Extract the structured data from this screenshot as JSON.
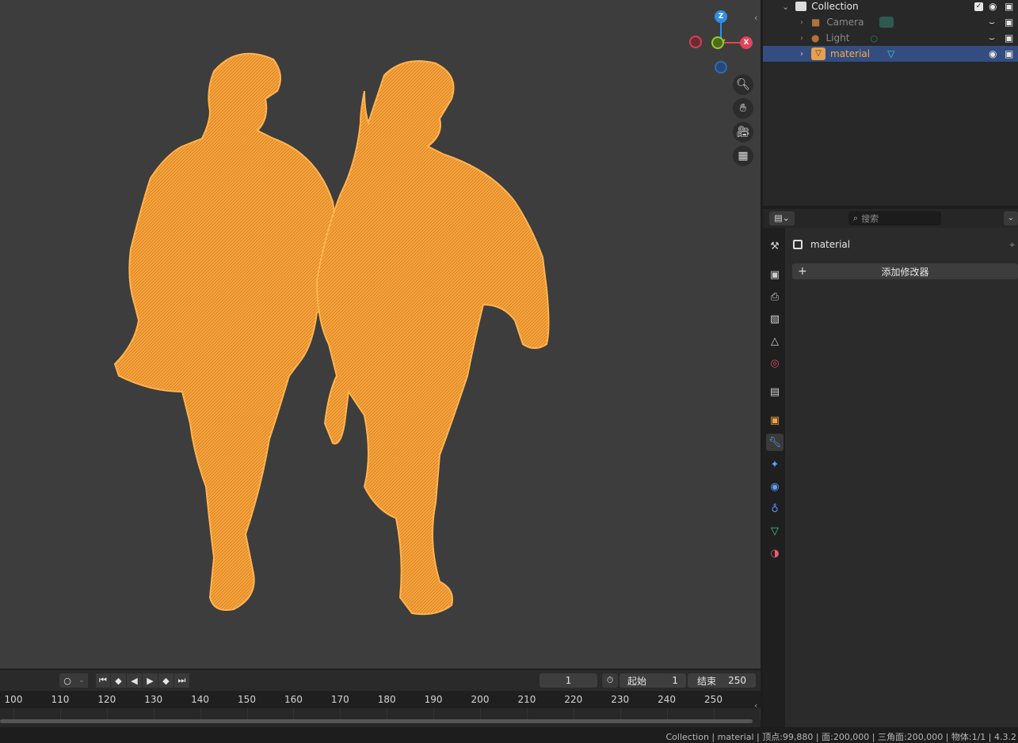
{
  "outliner": {
    "collection": "Collection",
    "items": [
      {
        "label": "Camera"
      },
      {
        "label": "Light"
      },
      {
        "label": "material"
      }
    ]
  },
  "properties": {
    "search_placeholder": "搜索",
    "object_name": "material",
    "add_modifier": "添加修改器"
  },
  "gizmo": {
    "z": "Z",
    "x": "X"
  },
  "timeline": {
    "current_frame": "1",
    "start_label": "起始",
    "start_value": "1",
    "end_label": "结束",
    "end_value": "250",
    "ticks": [
      "100",
      "110",
      "120",
      "130",
      "140",
      "150",
      "160",
      "170",
      "180",
      "190",
      "200",
      "210",
      "220",
      "230",
      "240",
      "250"
    ]
  },
  "statusbar": {
    "text": "Collection | material | 顶点:99,880 | 面:200,000 | 三角面:200,000 | 物体:1/1 | 4.3.2"
  },
  "colors": {
    "selected_orange": "#ff9a2a",
    "axis_x": "#e8405a",
    "axis_y": "#8fcf2a",
    "axis_z": "#2e8fe8",
    "selection_blue": "#334d80"
  }
}
